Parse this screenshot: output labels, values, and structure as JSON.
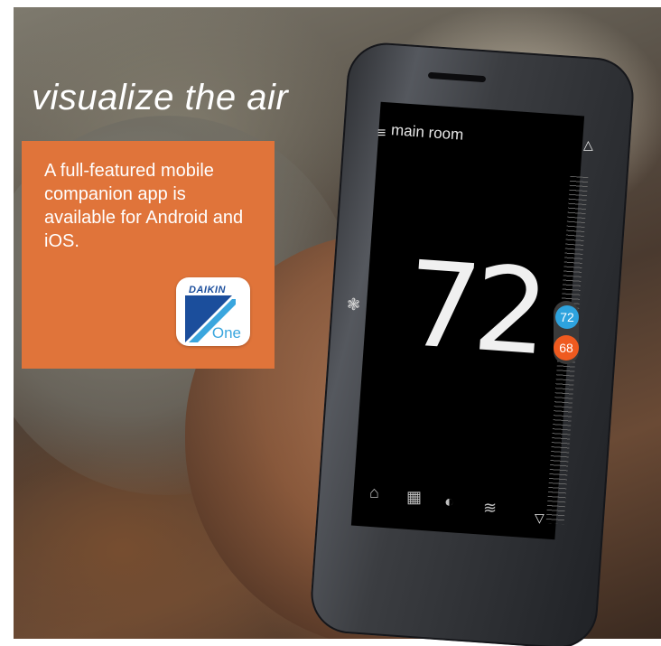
{
  "headline": "visualize the air",
  "promo": {
    "text": "A full-featured mobile companion app is available for Android and iOS.",
    "app_icon": {
      "brand": "DAIKIN",
      "label": "One"
    }
  },
  "thermostat": {
    "room_name": "main room",
    "current_temp": "72",
    "cool_setpoint": "72",
    "heat_setpoint": "68"
  },
  "icons": {
    "menu": "≡",
    "up": "△",
    "down": "▽",
    "fan": "❃",
    "home": "⌂",
    "schedule": "▦",
    "eco": "◐",
    "air": "≋"
  },
  "colors": {
    "promo_bg": "#e0743a",
    "cool": "#2ea3de",
    "heat": "#ef5a1f",
    "brand": "#1b4e9c"
  }
}
